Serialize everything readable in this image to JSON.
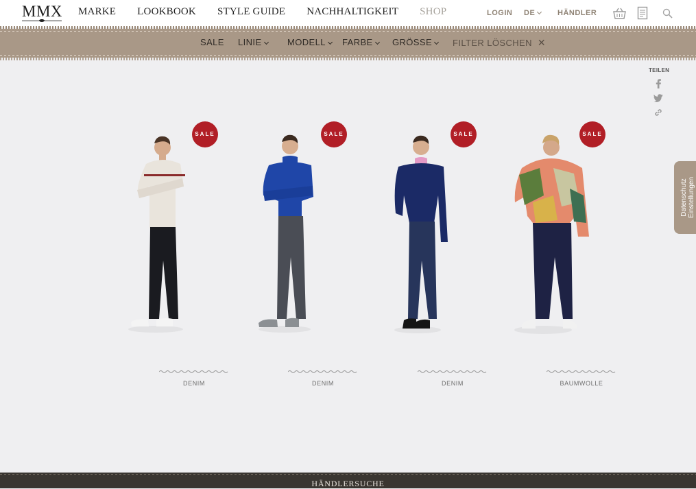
{
  "header": {
    "logo": "MMX",
    "nav": [
      "MARKE",
      "LOOKBOOK",
      "STYLE GUIDE",
      "NACHHALTIGKEIT",
      "SHOP"
    ],
    "login": "LOGIN",
    "language": "DE",
    "dealer": "HÄNDLER",
    "icons": [
      "basket-icon",
      "catalog-icon",
      "search-icon"
    ]
  },
  "filters": {
    "items": [
      "SALE",
      "LINIE",
      "MODELL",
      "FARBE",
      "GRÖSSE"
    ],
    "clear": "FILTER LÖSCHEN"
  },
  "share": {
    "label": "TEILEN",
    "icons": [
      "facebook-icon",
      "twitter-icon",
      "link-icon"
    ]
  },
  "privacy": {
    "line1": "Datenschutz",
    "line2": "Einstellungen"
  },
  "products": [
    {
      "badge": "SALE",
      "material": "DENIM",
      "top_color": "#e9e4dc",
      "stripe_color": "#8a2a2a",
      "pants_color": "#1a1b20",
      "shoe_color": "#f4f4f4"
    },
    {
      "badge": "SALE",
      "material": "DENIM",
      "top_color": "#1f46a8",
      "stripe_color": "",
      "pants_color": "#4a4d55",
      "shoe_color": "#8b8f93"
    },
    {
      "badge": "SALE",
      "material": "DENIM",
      "top_color": "#1b2a66",
      "stripe_color": "",
      "pants_color": "#27355b",
      "shoe_color": "#151515"
    },
    {
      "badge": "SALE",
      "material": "BAUMWOLLE",
      "top_color": "#e48a6c",
      "stripe_color": "#5b7d3c",
      "pants_color": "#1e2244",
      "shoe_color": "#f1f1f1"
    }
  ],
  "footer": {
    "label": "HÄNDLERSUCHE"
  },
  "colors": {
    "accent": "#a99887",
    "sale": "#b11e26",
    "footer": "#3a3631",
    "link_brown": "#8e8274"
  }
}
